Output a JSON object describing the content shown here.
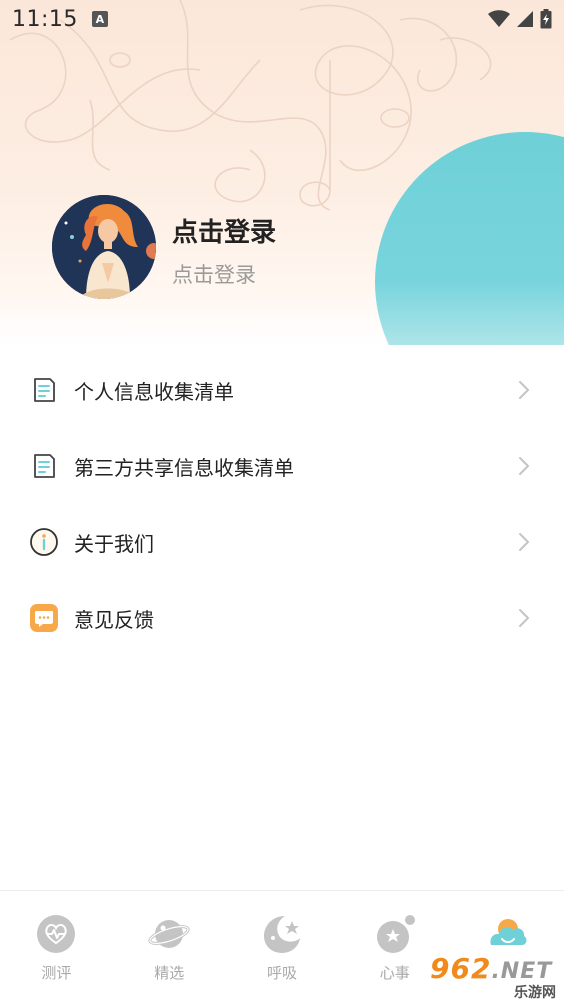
{
  "status_bar": {
    "time": "11:15",
    "notification_icon": "a-letter-icon",
    "icons": [
      "wifi-icon",
      "signal-icon",
      "battery-charging-icon"
    ]
  },
  "profile": {
    "title": "点击登录",
    "subtitle": "点击登录",
    "avatar_icon": "meditating-woman-avatar"
  },
  "menu": {
    "items": [
      {
        "label": "个人信息收集清单",
        "icon": "document-list-icon"
      },
      {
        "label": "第三方共享信息收集清单",
        "icon": "document-list-icon"
      },
      {
        "label": "关于我们",
        "icon": "info-icon"
      },
      {
        "label": "意见反馈",
        "icon": "feedback-chat-icon"
      }
    ]
  },
  "tabbar": {
    "tabs": [
      {
        "label": "测评",
        "icon": "heart-pulse-icon",
        "active": false
      },
      {
        "label": "精选",
        "icon": "planet-icon",
        "active": false
      },
      {
        "label": "呼吸",
        "icon": "moon-star-icon",
        "active": false
      },
      {
        "label": "心事",
        "icon": "globe-star-icon",
        "active": false
      },
      {
        "label": "",
        "icon": "cloud-smile-icon",
        "active": true
      }
    ]
  },
  "watermark": {
    "top": "962",
    "top_suffix": ".NET",
    "bottom": "乐游网"
  },
  "colors": {
    "accent_teal": "#6fd0d8",
    "header_peach": "#fbe7d9",
    "feedback_orange": "#f7a94a",
    "inactive_tab": "#c4c4c4"
  }
}
